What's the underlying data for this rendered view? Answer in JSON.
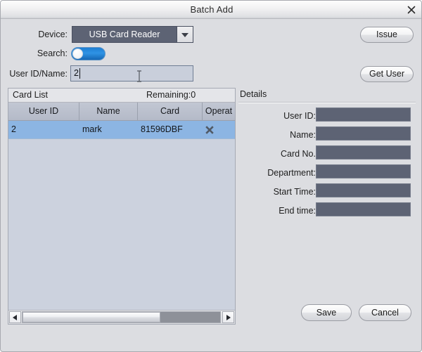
{
  "window": {
    "title": "Batch Add",
    "close_icon": "close-icon"
  },
  "form": {
    "device_label": "Device:",
    "device_value": "USB Card Reader",
    "device_arrow_icon": "chevron-down-icon",
    "search_label": "Search:",
    "search_enabled": true,
    "userid_label": "User ID/Name:",
    "userid_value": "2",
    "userid_placeholder": "",
    "issue_label": "Issue",
    "get_user_label": "Get User"
  },
  "card_list": {
    "title": "Card List",
    "remaining": "Remaining:0",
    "columns": [
      "User ID",
      "Name",
      "Card",
      "Operat"
    ],
    "rows": [
      {
        "user_id": "2",
        "name": "mark",
        "card": "81596DBF",
        "delete_icon": "delete-x-icon"
      }
    ],
    "scrollbar": {
      "left_arrow_icon": "arrow-left-icon",
      "right_arrow_icon": "arrow-right-icon"
    }
  },
  "details": {
    "title": "Details",
    "fields": [
      {
        "label": "User ID:",
        "value": ""
      },
      {
        "label": "Name:",
        "value": ""
      },
      {
        "label": "Card No.",
        "value": ""
      },
      {
        "label": "Department:",
        "value": ""
      },
      {
        "label": "Start Time:",
        "value": ""
      },
      {
        "label": "End time:",
        "value": ""
      }
    ]
  },
  "footer": {
    "save_label": "Save",
    "cancel_label": "Cancel"
  },
  "colors": {
    "dialog_background": "#dcdde1",
    "accent_toggle": "#2f93e4",
    "selected_row": "#8cb5e3",
    "field_dark": "#5d6374",
    "list_background": "#ccd2de",
    "table_header": "#b9bfcc"
  }
}
